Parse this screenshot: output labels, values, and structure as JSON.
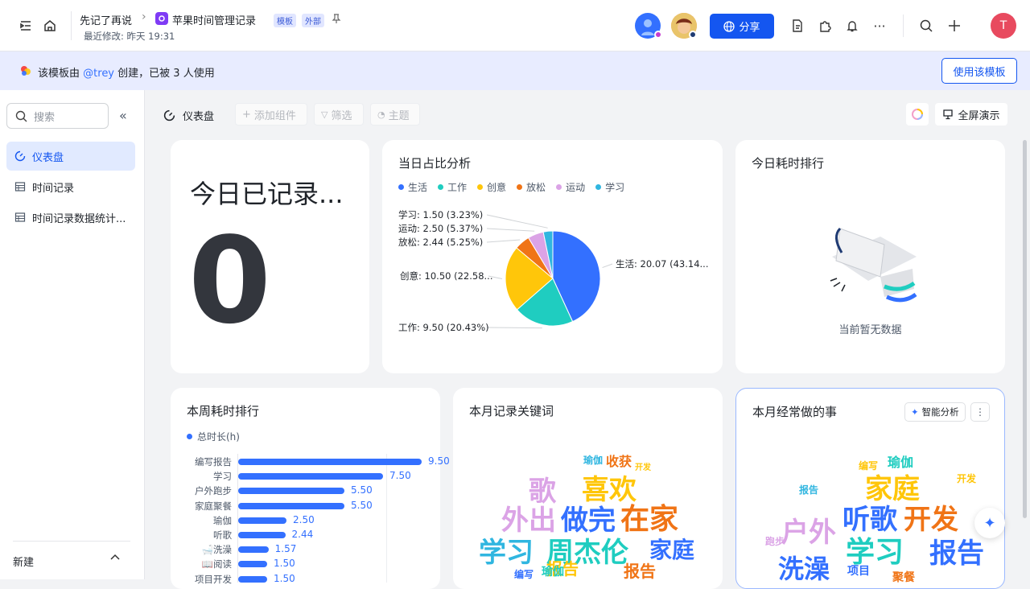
{
  "topbar": {
    "breadcrumb_parent": "先记了再说",
    "doc_title": "苹果时间管理记录",
    "tag_template": "模板",
    "tag_external": "外部",
    "last_modified": "最近修改: 昨天 19:31",
    "share_label": "分享",
    "avatar_letter": "T"
  },
  "banner": {
    "text_prefix": "该模板由",
    "mention": "@trey",
    "text_suffix": "创建，已被 3 人使用",
    "use_template_label": "使用该模板"
  },
  "sidebar": {
    "search_placeholder": "搜索",
    "items": [
      {
        "label": "仪表盘"
      },
      {
        "label": "时间记录"
      },
      {
        "label": "时间记录数据统计..."
      }
    ],
    "new_label": "新建"
  },
  "toolbar": {
    "dashboard_label": "仪表盘",
    "add_component": "添加组件",
    "filter": "筛选",
    "theme": "主题",
    "fullscreen": "全屏演示"
  },
  "cards": {
    "today_recorded": {
      "title": "今日已记录...",
      "value": "0"
    },
    "pie": {
      "title": "当日占比分析"
    },
    "today_rank": {
      "title": "今日耗时排行",
      "empty_text": "当前暂无数据"
    },
    "week_rank": {
      "title": "本周耗时排行"
    },
    "keywords": {
      "title": "本月记录关键词"
    },
    "frequent": {
      "title": "本月经常做的事",
      "ai_label": "智能分析"
    }
  },
  "chart_data": [
    {
      "type": "pie",
      "title": "当日占比分析",
      "legend_position": "top-left",
      "categories": [
        "生活",
        "工作",
        "创意",
        "放松",
        "运动",
        "学习"
      ],
      "values": [
        20.07,
        9.5,
        10.5,
        2.44,
        2.5,
        1.5
      ],
      "colors": [
        "#3370ff",
        "#1fcdc0",
        "#ffc60a",
        "#f07416",
        "#dba3e6",
        "#30b6e0"
      ],
      "labels": [
        "生活: 20.07 (43.14...",
        "工作: 9.50 (20.43%)",
        "创意: 10.50 (22.58...",
        "放松: 2.44 (5.25%)",
        "运动: 2.50 (5.37%)",
        "学习: 1.50 (3.23%)"
      ]
    },
    {
      "type": "bar",
      "orientation": "horizontal",
      "title": "本周耗时排行",
      "series": [
        {
          "name": "总时长(h)",
          "color": "#3370ff"
        }
      ],
      "categories": [
        "编写报告",
        "学习",
        "户外跑步",
        "家庭聚餐",
        "瑜伽",
        "听歌",
        "🛁洗澡",
        "📖阅读",
        "项目开发"
      ],
      "values": [
        9.5,
        7.5,
        5.5,
        5.5,
        2.5,
        2.44,
        1.57,
        1.5,
        1.5
      ],
      "value_labels": [
        "9.50",
        "7.50",
        "5.50",
        "5.50",
        "2.50",
        "2.44",
        "1.57",
        "1.50",
        "1.50"
      ]
    }
  ],
  "wordcloud_keywords": [
    {
      "text": "学习",
      "color": "#30b6e0"
    },
    {
      "text": "周杰伦",
      "color": "#1fcdc0"
    },
    {
      "text": "家庭",
      "color": "#3370ff"
    },
    {
      "text": "外出",
      "color": "#dba3e6"
    },
    {
      "text": "做完",
      "color": "#3370ff"
    },
    {
      "text": "在家",
      "color": "#f07416"
    },
    {
      "text": "喜欢",
      "color": "#ffc60a"
    },
    {
      "text": "歌",
      "color": "#dba3e6"
    },
    {
      "text": "收获",
      "color": "#f07416"
    },
    {
      "text": "瑜伽",
      "color": "#30b6e0"
    },
    {
      "text": "开发",
      "color": "#ffc60a"
    },
    {
      "text": "报告",
      "color": "#ffc60a"
    },
    {
      "text": "编写",
      "color": "#3370ff"
    },
    {
      "text": "瑜伽",
      "color": "#1fcdc0"
    },
    {
      "text": "报告",
      "color": "#f07416"
    }
  ],
  "wordcloud_frequent": [
    {
      "text": "学习",
      "color": "#1fcdc0"
    },
    {
      "text": "报告",
      "color": "#3370ff"
    },
    {
      "text": "户外",
      "color": "#dba3e6"
    },
    {
      "text": "听歌",
      "color": "#3370ff"
    },
    {
      "text": "开发",
      "color": "#f07416"
    },
    {
      "text": "家庭",
      "color": "#ffc60a"
    },
    {
      "text": "洗澡",
      "color": "#3370ff"
    },
    {
      "text": "瑜伽",
      "color": "#1fcdc0"
    },
    {
      "text": "编写",
      "color": "#ffc60a"
    },
    {
      "text": "项目",
      "color": "#3370ff"
    },
    {
      "text": "聚餐",
      "color": "#f07416"
    },
    {
      "text": "跑步",
      "color": "#dba3e6"
    },
    {
      "text": "报告",
      "color": "#30b6e0"
    },
    {
      "text": "开发",
      "color": "#ffc60a"
    }
  ]
}
